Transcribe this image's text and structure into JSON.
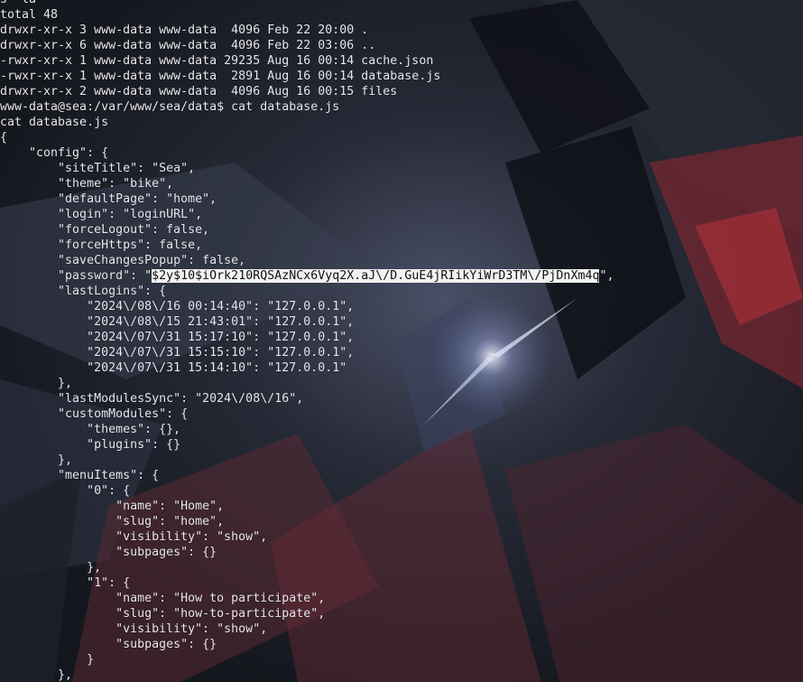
{
  "terminal": {
    "lines": [
      "s -la",
      "total 48",
      "drwxr-xr-x 3 www-data www-data  4096 Feb 22 20:00 .",
      "drwxr-xr-x 6 www-data www-data  4096 Feb 22 03:06 ..",
      "-rwxr-xr-x 1 www-data www-data 29235 Aug 16 00:14 cache.json",
      "-rwxr-xr-x 1 www-data www-data  2891 Aug 16 00:14 database.js",
      "drwxr-xr-x 2 www-data www-data  4096 Aug 16 00:15 files",
      "www-data@sea:/var/www/sea/data$ cat database.js",
      "cat database.js",
      "{",
      "    \"config\": {",
      "        \"siteTitle\": \"Sea\",",
      "        \"theme\": \"bike\",",
      "        \"defaultPage\": \"home\",",
      "        \"login\": \"loginURL\",",
      "        \"forceLogout\": false,",
      "        \"forceHttps\": false,",
      "        \"saveChangesPopup\": false,",
      "        \"password\": \"$2y$10$iOrk210RQSAzNCx6Vyq2X.aJ\\/D.GuE4jRIikYiWrD3TM\\/PjDnXm4q\",",
      "        \"lastLogins\": {",
      "            \"2024\\/08\\/16 00:14:40\": \"127.0.0.1\",",
      "            \"2024\\/08\\/15 21:43:01\": \"127.0.0.1\",",
      "            \"2024\\/07\\/31 15:17:10\": \"127.0.0.1\",",
      "            \"2024\\/07\\/31 15:15:10\": \"127.0.0.1\",",
      "            \"2024\\/07\\/31 15:14:10\": \"127.0.0.1\"",
      "        },",
      "        \"lastModulesSync\": \"2024\\/08\\/16\",",
      "        \"customModules\": {",
      "            \"themes\": {},",
      "            \"plugins\": {}",
      "        },",
      "        \"menuItems\": {",
      "            \"0\": {",
      "                \"name\": \"Home\",",
      "                \"slug\": \"home\",",
      "                \"visibility\": \"show\",",
      "                \"subpages\": {}",
      "            },",
      "            \"1\": {",
      "                \"name\": \"How to participate\",",
      "                \"slug\": \"how-to-participate\",",
      "                \"visibility\": \"show\",",
      "                \"subpages\": {}",
      "            }",
      "        },"
    ],
    "selection": {
      "line": 18,
      "text": "$2y$10$iOrk210RQSAzNCx6Vyq2X.aJ\\/D.GuE4jRIikYiWrD3TM\\/PjDnXm4q"
    }
  },
  "colors": {
    "text": "#e8e8ec",
    "selection_bg": "#f2f2f2",
    "selection_fg": "#101010",
    "background": "#1b1e26"
  }
}
